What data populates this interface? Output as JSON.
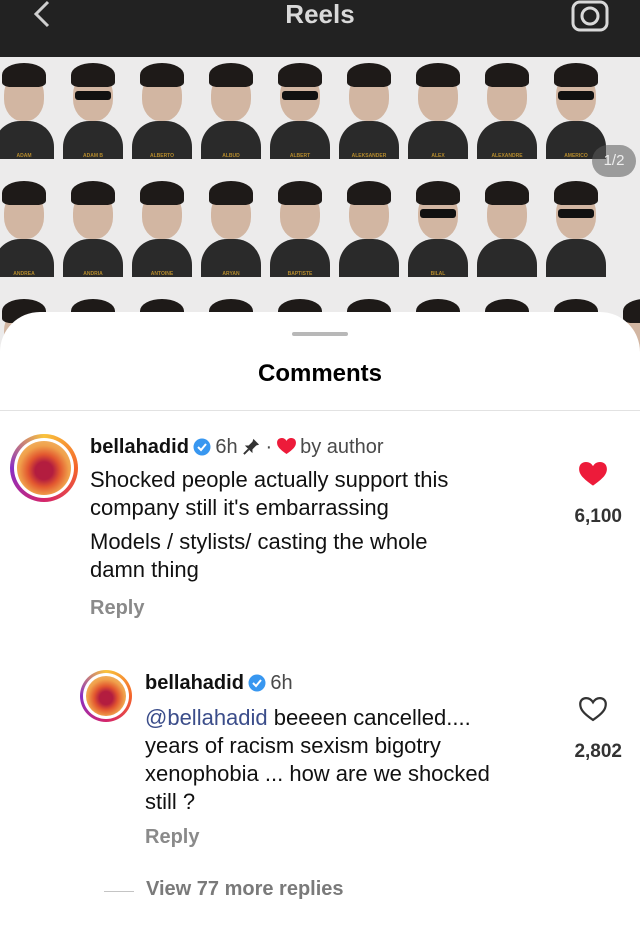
{
  "header": {
    "title": "Reels",
    "back_icon": "chevron-left-icon",
    "camera_icon": "camera-icon"
  },
  "reel": {
    "pager": "1/2",
    "labels_row1": [
      "ADAM",
      "ADAM B",
      "ALBERTO",
      "ALBUD",
      "ALBERT",
      "ALEKSANDER",
      "ALEX",
      "ALEXANDRE",
      "AMERICO"
    ],
    "labels_row2": [
      "ANDREA",
      "ANDRIA",
      "ANTOINE",
      "ARYAN",
      "BAPTISTE",
      "",
      "BILAL",
      "",
      ""
    ]
  },
  "sheet": {
    "title": "Comments"
  },
  "comments": [
    {
      "username": "bellahadid",
      "time": "6h",
      "author_label": "by author",
      "text_lines": [
        "Shocked people actually support this",
        "company still it's embarrassing"
      ],
      "text_lines_2": [
        "Models / stylists/ casting the whole",
        "damn thing"
      ],
      "likes": "6,100",
      "liked": true,
      "reply_label": "Reply"
    },
    {
      "username": "bellahadid",
      "time": "6h",
      "mention": "@bellahadid",
      "text_first_rest": " beeeen cancelled....",
      "text_lines": [
        "years of racism sexism bigotry",
        "xenophobia ... how are we shocked",
        "still ?"
      ],
      "likes": "2,802",
      "liked": false,
      "reply_label": "Reply"
    }
  ],
  "view_more": "View 77 more replies",
  "colors": {
    "heart_red": "#ed1b3a",
    "verified_blue": "#3897f0",
    "mention_blue": "#3b4d8a"
  }
}
